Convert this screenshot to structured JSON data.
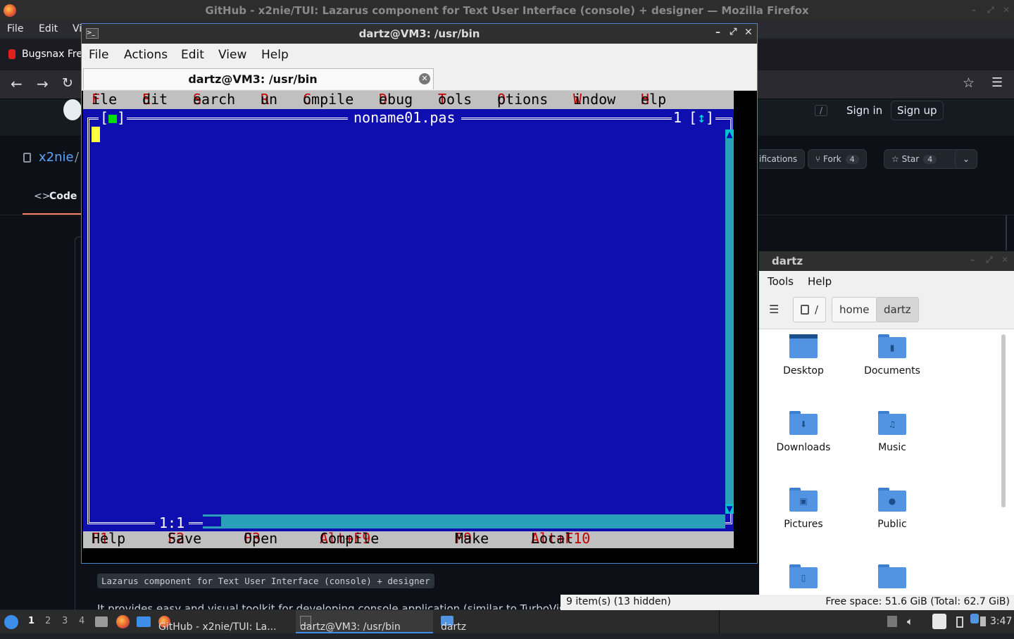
{
  "firefox": {
    "title": "GitHub - x2nie/TUI: Lazarus component for Text User Interface (console) + designer — Mozilla Firefox",
    "menu": [
      "File",
      "Edit",
      "Vi"
    ],
    "tab_label": "Bugsnax Fre",
    "github": {
      "sign_in": "Sign in",
      "sign_up": "Sign up",
      "slash": "/",
      "repo_owner": "x2nie",
      "repo_sep": "/",
      "code_tab": "Code",
      "notifications": "ifications",
      "fork_label": "Fork",
      "fork_count": "4",
      "star_label": "Star",
      "star_count": "4",
      "about": "Lazarus component for Text User Interface (console) + designer",
      "description": "It provides easy and visual toolkit for developing console application (similar to TurboVision / F"
    }
  },
  "terminal": {
    "title": "dartz@VM3: /usr/bin",
    "menu": [
      "File",
      "Actions",
      "Edit",
      "View",
      "Help"
    ],
    "tab_title": "dartz@VM3: /usr/bin"
  },
  "ide": {
    "menu": [
      {
        "hot": "F",
        "rest": "ile"
      },
      {
        "hot": "E",
        "rest": "dit"
      },
      {
        "hot": "S",
        "rest": "earch"
      },
      {
        "hot": "R",
        "rest": "un"
      },
      {
        "hot": "C",
        "rest": "ompile"
      },
      {
        "hot": "D",
        "rest": "ebug"
      },
      {
        "hot": "T",
        "rest": "ools"
      },
      {
        "hot": "O",
        "rest": "ptions"
      },
      {
        "hot": "W",
        "rest": "indow"
      },
      {
        "hot": "H",
        "rest": "elp"
      }
    ],
    "window_title": "noname01.pas",
    "close_box_left": "[",
    "close_box_glyph": "■",
    "close_box_right": "]",
    "window_number": "1",
    "zoom_left": "[",
    "zoom_glyph": "↕",
    "zoom_right": "]",
    "cursor_pos": "1:1",
    "status": [
      {
        "key": "F1",
        "label": "Help"
      },
      {
        "key": "F2",
        "label": "Save"
      },
      {
        "key": "F3",
        "label": "Open"
      },
      {
        "key": "Alt+F9",
        "label": "Compile"
      },
      {
        "key": "F9",
        "label": "Make"
      },
      {
        "key": "Alt+F10",
        "label": "Local menu"
      }
    ]
  },
  "file_manager": {
    "title": "dartz",
    "menu": [
      "Tools",
      "Help"
    ],
    "path": [
      "/",
      "home",
      "dartz"
    ],
    "items": [
      {
        "name": "Desktop",
        "icon": "desktop-folder-icon"
      },
      {
        "name": "Documents",
        "icon": "documents-folder-icon"
      },
      {
        "name": "Downloads",
        "icon": "downloads-folder-icon"
      },
      {
        "name": "Music",
        "icon": "music-folder-icon"
      },
      {
        "name": "Pictures",
        "icon": "pictures-folder-icon"
      },
      {
        "name": "Public",
        "icon": "public-folder-icon"
      },
      {
        "name": "",
        "icon": "templates-folder-icon"
      },
      {
        "name": "",
        "icon": "videos-folder-icon"
      }
    ],
    "status_left": "9 item(s) (13 hidden)",
    "status_right": "Free space: 51.6 GiB (Total: 62.7 GiB)"
  },
  "taskbar": {
    "workspaces": [
      "1",
      "2",
      "3",
      "4"
    ],
    "tasks": [
      "GitHub - x2nie/TUI: La...",
      "dartz@VM3: /usr/bin",
      "dartz"
    ],
    "clock": "3:47"
  },
  "colors": {
    "ide_blue": "#0f0fb0",
    "ide_gray": "#c0c0c0",
    "hotkey_red": "#c40000",
    "folder_blue": "#5294e2"
  }
}
